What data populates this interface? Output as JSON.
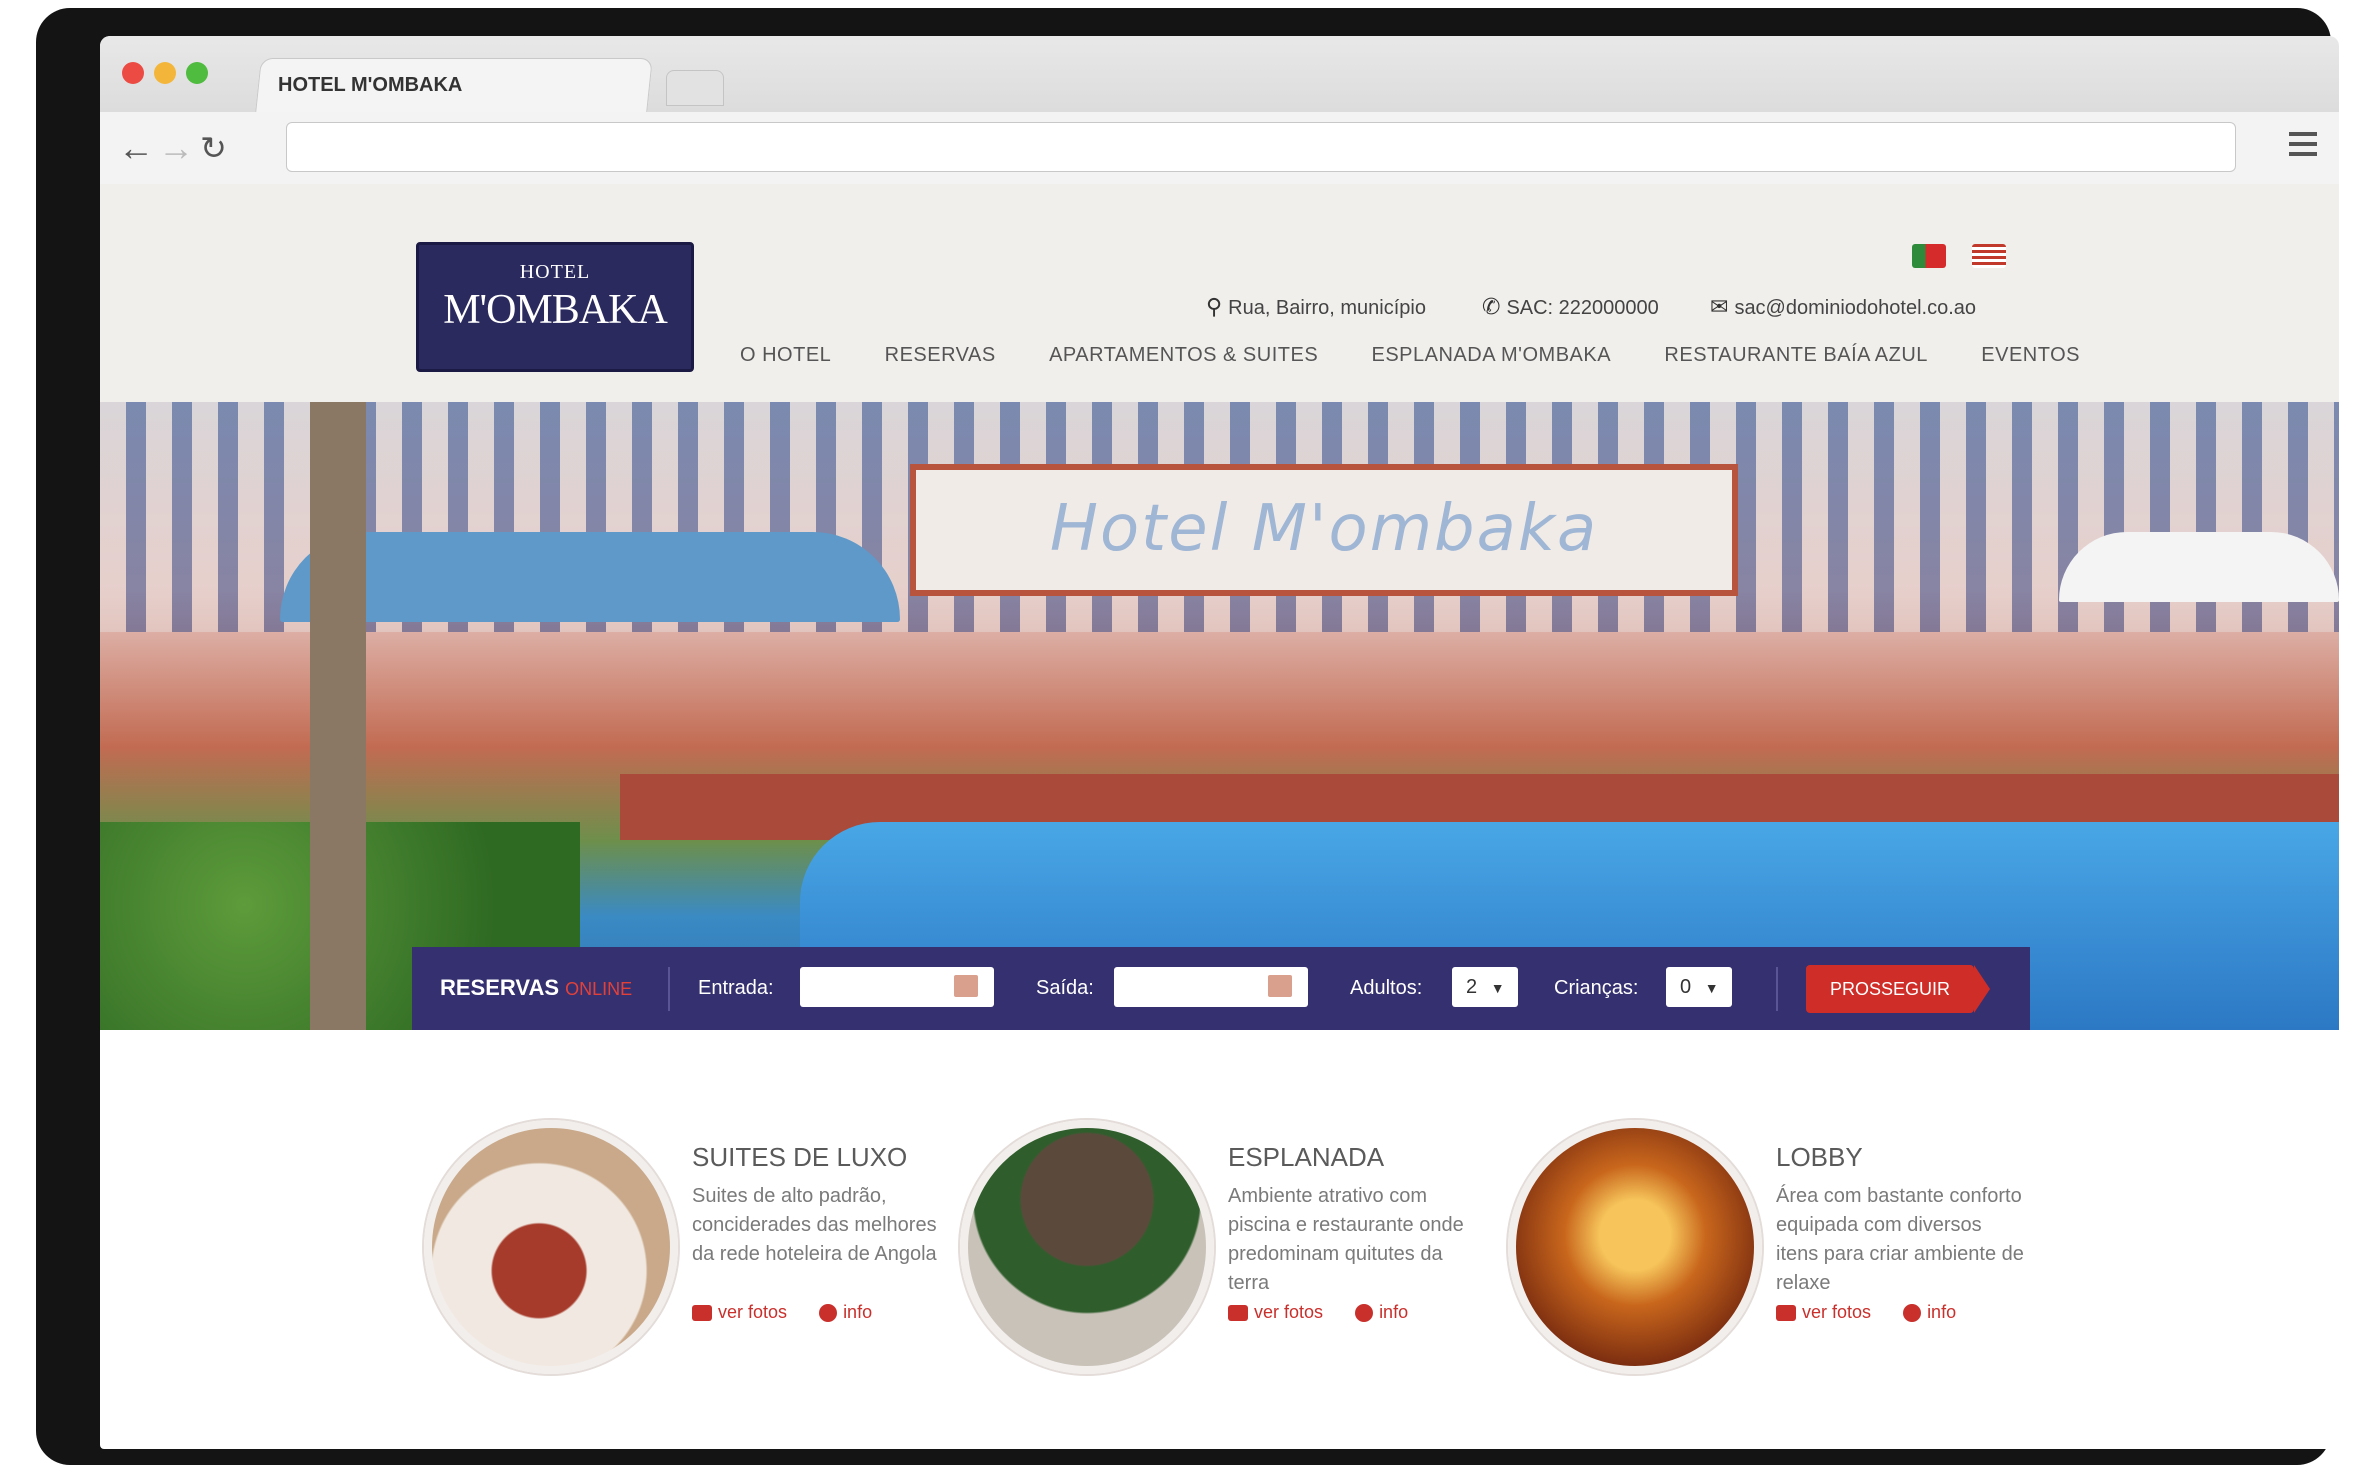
{
  "browser": {
    "tab_title": "HOTEL M'OMBAKA",
    "url": "",
    "traffic_colors": [
      "#ec4b44",
      "#f3b63a",
      "#4fbb3f"
    ]
  },
  "site": {
    "logo": {
      "line1": "HOTEL",
      "line2": "M'OMBAKA"
    },
    "languages": [
      "Português",
      "English"
    ],
    "contact": {
      "address": "Rua, Bairro, município",
      "phone": "SAC: 222000000",
      "email": "sac@dominiodohotel.co.ao"
    },
    "nav": [
      {
        "label": "O HOTEL"
      },
      {
        "label": "RESERVAS"
      },
      {
        "label": "APARTAMENTOS & SUITES"
      },
      {
        "label": "ESPLANADA M'OMBAKA"
      },
      {
        "label": "RESTAURANTE BAÍA AZUL"
      },
      {
        "label": "EVENTOS"
      }
    ],
    "hero_sign": "Hotel M'ombaka",
    "reservations": {
      "title": "RESERVAS",
      "title_suffix": "ONLINE",
      "checkin_label": "Entrada:",
      "checkin_value": "",
      "checkout_label": "Saída:",
      "checkout_value": "",
      "adults_label": "Adultos:",
      "adults_value": "2",
      "children_label": "Crianças:",
      "children_value": "0",
      "submit_label": "PROSSEGUIR"
    },
    "features": [
      {
        "title": "SUITES DE LUXO",
        "description": "Suites de alto padrão, conciderades das melhores da rede hoteleira de Angola",
        "photos_label": "ver fotos",
        "info_label": "info"
      },
      {
        "title": "ESPLANADA",
        "description": "Ambiente atrativo com piscina e restaurante onde predominam quitutes da terra",
        "photos_label": "ver fotos",
        "info_label": "info"
      },
      {
        "title": "LOBBY",
        "description": "Área com bastante conforto equipada com diversos itens para criar ambiente de relaxe",
        "photos_label": "ver fotos",
        "info_label": "info"
      }
    ],
    "colors": {
      "brand_navy": "#35306f",
      "accent_red": "#cf2e28"
    }
  }
}
